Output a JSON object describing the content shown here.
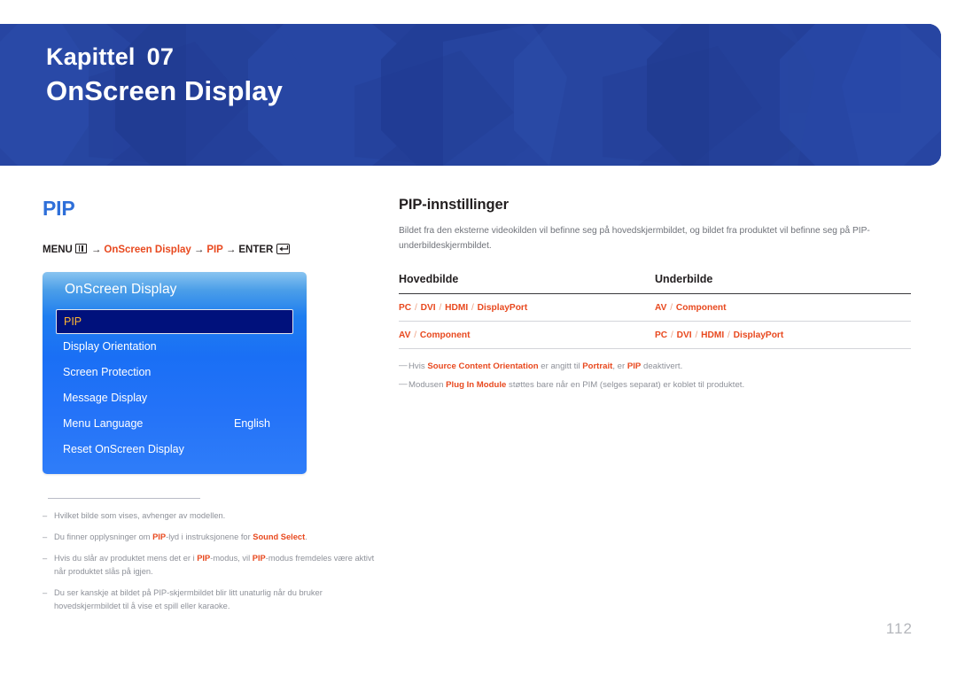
{
  "header": {
    "chapter_label": "Kapittel",
    "chapter_number": "07",
    "chapter_title": "OnScreen Display",
    "background_color": "#24409a"
  },
  "left": {
    "section_title": "PIP",
    "section_title_color": "#2e6fd9",
    "menu_path": {
      "menu_label": "MENU",
      "menu_icon": "menu-grid-icon",
      "step1": "OnScreen Display",
      "step2": "PIP",
      "enter_label": "ENTER",
      "enter_icon": "enter-key-icon",
      "arrow": "→",
      "accent_color": "#e8491f"
    },
    "osd": {
      "title": "OnScreen Display",
      "items": [
        {
          "label": "PIP",
          "value": "",
          "selected": true
        },
        {
          "label": "Display Orientation",
          "value": "",
          "selected": false
        },
        {
          "label": "Screen Protection",
          "value": "",
          "selected": false
        },
        {
          "label": "Message Display",
          "value": "",
          "selected": false
        },
        {
          "label": "Menu Language",
          "value": "English",
          "selected": false
        },
        {
          "label": "Reset OnScreen Display",
          "value": "",
          "selected": false
        }
      ]
    },
    "footnotes": [
      {
        "dash": "–",
        "parts": [
          {
            "t": "Hvilket bilde som vises, avhenger av modellen.",
            "b": false
          }
        ]
      },
      {
        "dash": "–",
        "parts": [
          {
            "t": "Du finner opplysninger om ",
            "b": false
          },
          {
            "t": "PIP",
            "b": true
          },
          {
            "t": "-lyd i instruksjonene for ",
            "b": false
          },
          {
            "t": "Sound Select",
            "b": true
          },
          {
            "t": ".",
            "b": false
          }
        ]
      },
      {
        "dash": "–",
        "parts": [
          {
            "t": "Hvis du slår av produktet mens det er i ",
            "b": false
          },
          {
            "t": "PIP",
            "b": true
          },
          {
            "t": "-modus, vil ",
            "b": false
          },
          {
            "t": "PIP",
            "b": true
          },
          {
            "t": "-modus fremdeles være aktivt når produktet slås på igjen.",
            "b": false
          }
        ]
      },
      {
        "dash": "–",
        "parts": [
          {
            "t": "Du ser kanskje at bildet på PIP-skjermbildet blir litt unaturlig når du bruker hovedskjermbildet til å vise et spill eller karaoke.",
            "b": false
          }
        ]
      }
    ]
  },
  "right": {
    "sub_title": "PIP-innstillinger",
    "intro": "Bildet fra den eksterne videokilden vil befinne seg på hovedskjermbildet, og bildet fra produktet vil befinne seg på PIP-underbildeskjermbildet.",
    "table": {
      "headers": [
        "Hovedbilde",
        "Underbilde"
      ],
      "rows": [
        {
          "main": [
            "PC",
            "DVI",
            "HDMI",
            "DisplayPort"
          ],
          "sub": [
            "AV",
            "Component"
          ]
        },
        {
          "main": [
            "AV",
            "Component"
          ],
          "sub": [
            "PC",
            "DVI",
            "HDMI",
            "DisplayPort"
          ]
        }
      ],
      "separator": "/",
      "value_color": "#e8491f"
    },
    "notes": [
      {
        "dash": "—",
        "parts": [
          {
            "t": "Hvis ",
            "b": false
          },
          {
            "t": "Source Content Orientation",
            "b": true
          },
          {
            "t": " er angitt til ",
            "b": false
          },
          {
            "t": "Portrait",
            "b": true
          },
          {
            "t": ", er ",
            "b": false
          },
          {
            "t": "PIP",
            "b": true
          },
          {
            "t": " deaktivert.",
            "b": false
          }
        ]
      },
      {
        "dash": "—",
        "parts": [
          {
            "t": "Modusen ",
            "b": false
          },
          {
            "t": "Plug In Module",
            "b": true
          },
          {
            "t": " støttes bare når en PIM (selges separat) er koblet til produktet.",
            "b": false
          }
        ]
      }
    ]
  },
  "page_number": "112"
}
